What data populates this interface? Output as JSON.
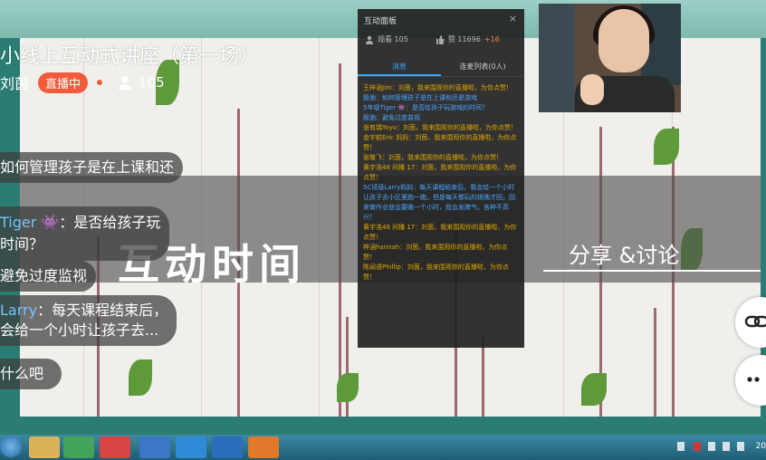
{
  "lecture": {
    "title": "小线上互动式讲座（第一场）",
    "host": "刘茵",
    "live_badge": "直播中",
    "viewer_count": "105"
  },
  "slide": {
    "big_title": "互动时间",
    "sub_title": "分享 &讨论"
  },
  "bubbles": [
    {
      "who": "",
      "text": "如何管理孩子是在上课和还"
    },
    {
      "who": "Tiger",
      "text": "：是否给孩子玩"
    },
    {
      "who": "",
      "text": "时间？"
    },
    {
      "who": "",
      "text": "避免过度监视"
    },
    {
      "who": "Larry",
      "text": "：每天课程结束后，"
    },
    {
      "who": "",
      "text": "会给一个小时让孩子去..."
    },
    {
      "who": "",
      "text": "什么吧"
    }
  ],
  "panel": {
    "title": "互动面板",
    "close": "×",
    "views_label": "观看 105",
    "likes_label": "赞 11696",
    "likes_delta": "+16",
    "tabs": [
      "消息",
      "连麦列表(0人)"
    ],
    "messages": [
      {
        "name": "王梓涵Jim",
        "text": "：刘茵，我来围观你的直播啦，为你点赞！",
        "color": "#e0a800"
      },
      {
        "name": "殷驰",
        "text": "：如何管理孩子是在上课和还是游戏",
        "color": "#4aa6ff"
      },
      {
        "name": "5年级Tiger 👾",
        "text": "：是否给孩子玩游戏的时间？",
        "color": "#4aa6ff"
      },
      {
        "name": "殷驰",
        "text": "：避免过度监视",
        "color": "#4aa6ff"
      },
      {
        "name": "张有瑞Yoyo",
        "text": "：刘茵，我来围观你的直播啦，为你点赞！",
        "color": "#e0a800"
      },
      {
        "name": "金宇航Eric 妈妈",
        "text": "：刘茵，我来围观你的直播啦，为你点赞！",
        "color": "#e0a800"
      },
      {
        "name": "张敬飞",
        "text": "：刘茵，我来围观你的直播啦，为你点赞！",
        "color": "#e0a800"
      },
      {
        "name": "黄宇浩",
        "text": "48 间播 17：刘茵，我来围观你的直播啦，为你点赞！",
        "color": "#e0a800"
      },
      {
        "name": "5C班级Larry妈妈",
        "text": "：每天课程结束后，我会给一个小时让孩子去小区里跑一跑，但是每天都玩的很晚才回，回来做作业就会要晚一个小时，就会发脾气，各种不高兴！",
        "color": "#4aa6ff"
      },
      {
        "name": "黄宇浩",
        "text": "48 间播 17：刘茵，我来围观你的直播啦，为你点赞！",
        "color": "#e0a800"
      },
      {
        "name": "梓涵hannah",
        "text": "：刘茵，我来围观你的直播啦，为你点赞！",
        "color": "#e0a800"
      },
      {
        "name": "陈闻语Phillip",
        "text": "：刘茵，我来围观你的直播啦，为你点赞！",
        "color": "#e0a800"
      }
    ]
  },
  "taskbar": {
    "time": "20"
  }
}
